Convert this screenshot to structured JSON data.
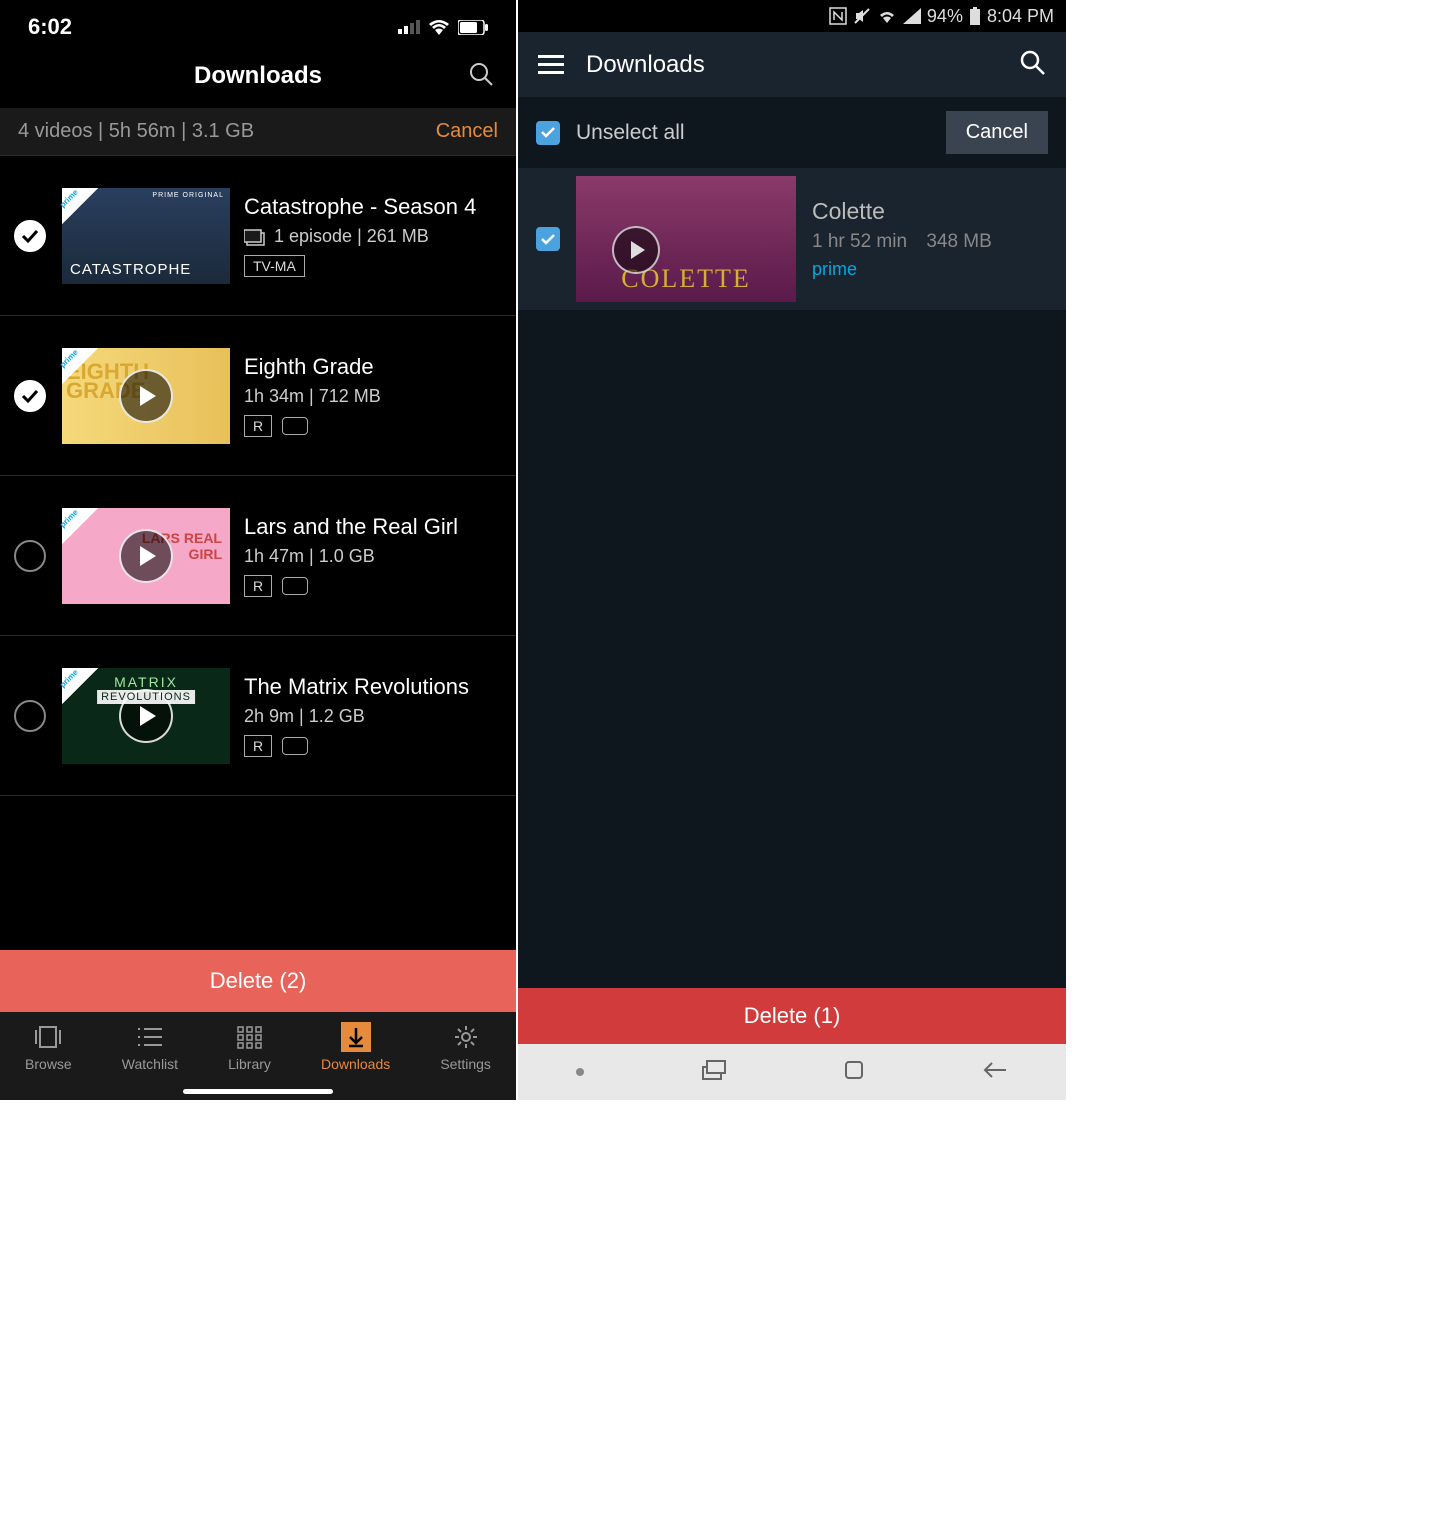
{
  "left": {
    "statusbar": {
      "time": "6:02"
    },
    "header": {
      "title": "Downloads"
    },
    "summary": {
      "text": "4 videos | 5h 56m | 3.1 GB",
      "cancel": "Cancel"
    },
    "items": [
      {
        "title": "Catastrophe - Season 4",
        "sub": "1 episode | 261 MB",
        "rating": "TV-MA",
        "checked": true,
        "hasCC": false,
        "hasEpisodesIcon": true,
        "hasPlay": false
      },
      {
        "title": "Eighth Grade",
        "sub": "1h 34m | 712 MB",
        "rating": "R",
        "checked": true,
        "hasCC": true,
        "hasEpisodesIcon": false,
        "hasPlay": true
      },
      {
        "title": "Lars and the Real Girl",
        "sub": "1h 47m | 1.0 GB",
        "rating": "R",
        "checked": false,
        "hasCC": true,
        "hasEpisodesIcon": false,
        "hasPlay": true
      },
      {
        "title": "The Matrix Revolutions",
        "sub": "2h 9m | 1.2 GB",
        "rating": "R",
        "checked": false,
        "hasCC": true,
        "hasEpisodesIcon": false,
        "hasPlay": true
      }
    ],
    "deleteLabel": "Delete (2)",
    "tabs": [
      {
        "label": "Browse"
      },
      {
        "label": "Watchlist"
      },
      {
        "label": "Library"
      },
      {
        "label": "Downloads"
      },
      {
        "label": "Settings"
      }
    ]
  },
  "right": {
    "statusbar": {
      "battery": "94%",
      "time": "8:04 PM"
    },
    "header": {
      "title": "Downloads"
    },
    "selectbar": {
      "unselect": "Unselect all",
      "cancel": "Cancel"
    },
    "items": [
      {
        "title": "Colette",
        "duration": "1 hr 52 min",
        "size": "348 MB",
        "prime": "prime",
        "checked": true
      }
    ],
    "deleteLabel": "Delete (1)"
  }
}
